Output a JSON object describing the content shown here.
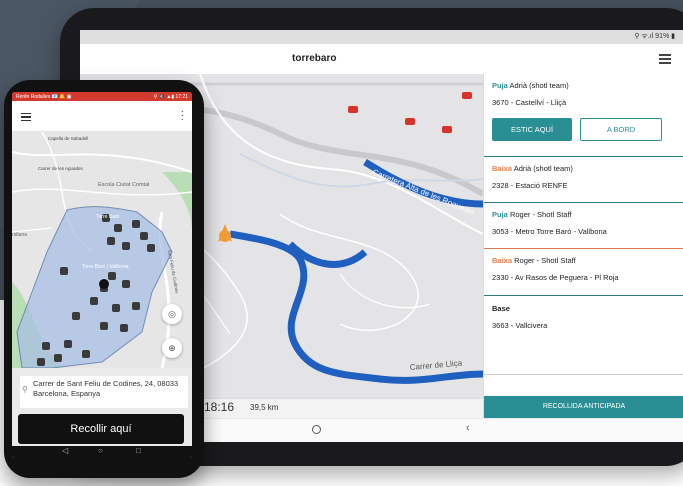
{
  "tablet": {
    "status": "⚲ ᯤ.ıl 91% ▮",
    "title": "torrebaro",
    "map_labels": {
      "road1": "Carretera Alta de les Roquetes",
      "road2": "Carrer de Lliça"
    },
    "bottom": {
      "time": "18:16",
      "distance": "39,5 km"
    },
    "nav": {
      "home": "○",
      "back": "‹"
    },
    "cards": [
      {
        "keyword": "Puja",
        "type": "puja",
        "name": "Adrià (shotl team)",
        "stop": "3670 - Castellví - Lliçà"
      },
      {
        "keyword": "Baixa",
        "type": "baixa",
        "name": "Adrià (shotl team)",
        "stop": "2328 - Estació RENFE"
      },
      {
        "keyword": "Puja",
        "type": "puja",
        "name": "Roger - Shotl Staff",
        "stop": "3053 - Metro Torre Baró  - Vallbona"
      },
      {
        "keyword": "Baixa",
        "type": "baixa",
        "name": "Roger - Shotl Staff",
        "stop": "2330 - Av Rasos de Peguera - Pl Roja"
      },
      {
        "keyword": "Base",
        "type": "base",
        "name": "",
        "stop": "3663 - Vallcivera"
      }
    ],
    "buttons": {
      "estic": "ESTIC AQUÍ",
      "bord": "A BORD",
      "recollida": "RECOLLIDA ANTICIPADA"
    }
  },
  "phone": {
    "status_left": "Renfe Rodalies 📧 🔔 ▣",
    "status_right": "⚲ 🔇 ▲▮ 17:21",
    "map_labels": {
      "capella": "Capella de Sabadell",
      "aguades": "Carrer de les Aguades",
      "escola": "Escola Ciutat Comtal",
      "torre_label1": "Torre Baró",
      "torre_label2": "Torre Baró | Vallbona",
      "ridiana": "ridiana",
      "sant": "Sant Feliu de Codines"
    },
    "address": "Carrer de Sant Feliu de Codines, 24, 08033 Barcelona, Espanya",
    "cta": "Recollir aquí",
    "nav": {
      "back": "◁",
      "home": "○",
      "recent": "□"
    }
  },
  "colors": {
    "teal": "#2a8f95",
    "orange": "#e67e4a",
    "route": "#1f5fbf",
    "zone": "#a9c0e6"
  }
}
